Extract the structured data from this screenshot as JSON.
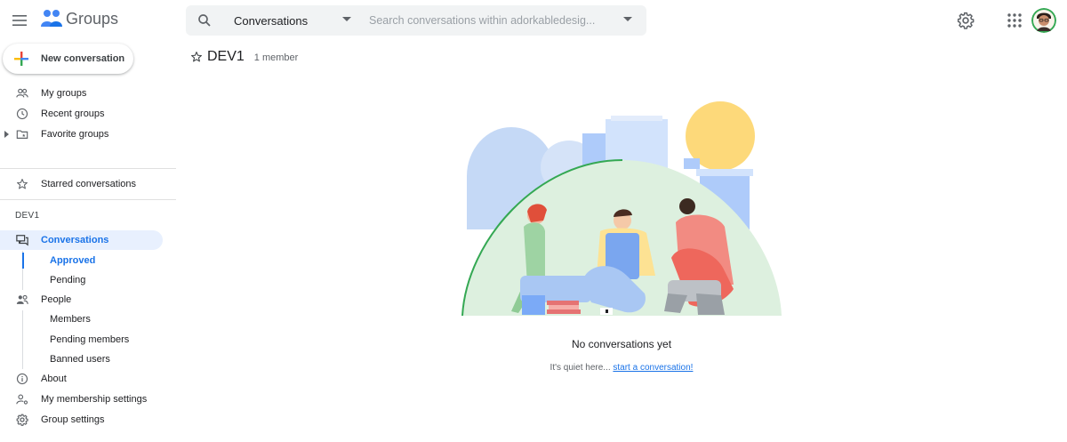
{
  "app": {
    "name": "Groups"
  },
  "search": {
    "scope_label": "Conversations",
    "placeholder": "Search conversations within adorkabledesig...",
    "value": ""
  },
  "sidebar": {
    "new_conversation_label": "New conversation",
    "top_items": [
      {
        "label": "My groups",
        "icon": "people-icon"
      },
      {
        "label": "Recent groups",
        "icon": "clock-icon"
      },
      {
        "label": "Favorite groups",
        "icon": "folder-star-icon"
      }
    ],
    "starred_label": "Starred conversations",
    "group_section_label": "DEV1",
    "conversations_label": "Conversations",
    "conversation_subitems": [
      "Approved",
      "Pending"
    ],
    "people_label": "People",
    "people_subitems": [
      "Members",
      "Pending members",
      "Banned users"
    ],
    "about_label": "About",
    "membership_settings_label": "My membership settings",
    "group_settings_label": "Group settings"
  },
  "main": {
    "group_name": "DEV1",
    "member_count": "1 member",
    "empty_title": "No conversations yet",
    "empty_subtitle": "It's quiet here...",
    "start_link": "start a conversation!"
  },
  "colors": {
    "accent": "#1a73e8",
    "active_bg": "#e8f0fe",
    "search_bg": "#f1f3f4",
    "text": "#202124",
    "muted": "#5f6368"
  }
}
